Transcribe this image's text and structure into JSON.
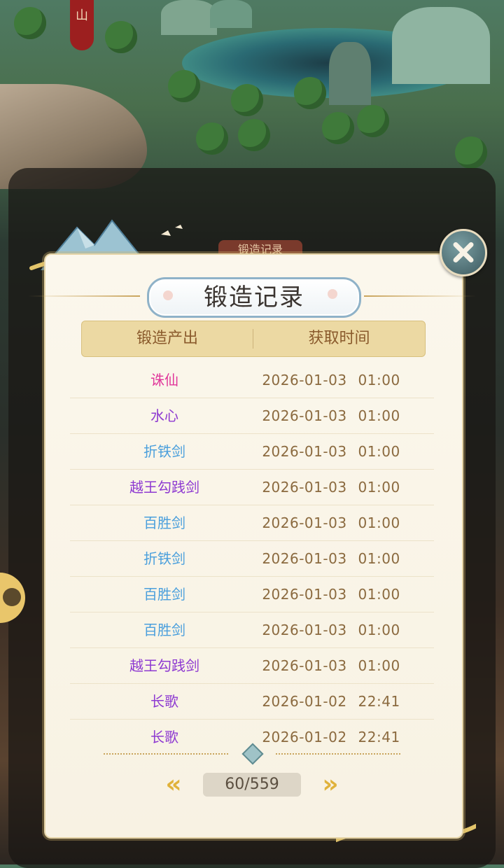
{
  "background": {
    "banner_char": "山",
    "behind_tab_label": "锻造记录"
  },
  "dialog": {
    "title": "锻造记录",
    "columns": [
      "锻造产出",
      "获取时间"
    ],
    "rows": [
      {
        "item": "诛仙",
        "date": "2026-01-03",
        "time": "01:00",
        "color": "#e0369a"
      },
      {
        "item": "水心",
        "date": "2026-01-03",
        "time": "01:00",
        "color": "#8e3ad1"
      },
      {
        "item": "折铁剑",
        "date": "2026-01-03",
        "time": "01:00",
        "color": "#4a9fdc"
      },
      {
        "item": "越王勾践剑",
        "date": "2026-01-03",
        "time": "01:00",
        "color": "#8e3ad1"
      },
      {
        "item": "百胜剑",
        "date": "2026-01-03",
        "time": "01:00",
        "color": "#4a9fdc"
      },
      {
        "item": "折铁剑",
        "date": "2026-01-03",
        "time": "01:00",
        "color": "#4a9fdc"
      },
      {
        "item": "百胜剑",
        "date": "2026-01-03",
        "time": "01:00",
        "color": "#4a9fdc"
      },
      {
        "item": "百胜剑",
        "date": "2026-01-03",
        "time": "01:00",
        "color": "#4a9fdc"
      },
      {
        "item": "越王勾践剑",
        "date": "2026-01-03",
        "time": "01:00",
        "color": "#8e3ad1"
      },
      {
        "item": "长歌",
        "date": "2026-01-02",
        "time": "22:41",
        "color": "#8e3ad1"
      },
      {
        "item": "长歌",
        "date": "2026-01-02",
        "time": "22:41",
        "color": "#8e3ad1"
      }
    ],
    "pagination": {
      "current_page": "60",
      "total_pages": "559",
      "display": "60/559",
      "prev_icon": "double-chevron-left-icon",
      "next_icon": "double-chevron-right-icon"
    },
    "close_icon": "close-icon"
  },
  "colors": {
    "accent_gold": "#e0b23b",
    "header_bg": "#ecd9a3",
    "time_text": "#8b6a3f",
    "panel_bg": "#fbf7ec"
  }
}
